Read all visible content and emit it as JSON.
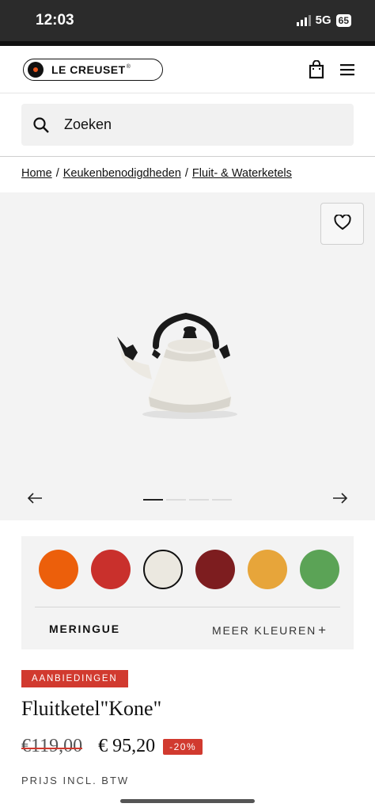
{
  "status_bar": {
    "time": "12:03",
    "network": "5G",
    "battery": "65"
  },
  "header": {
    "brand": "LE CREUSET",
    "brand_mark": "®",
    "icons": [
      "shopping-bag-icon",
      "menu-icon"
    ]
  },
  "search": {
    "placeholder": "Zoeken",
    "icon": "search-icon"
  },
  "breadcrumb": {
    "items": [
      "Home",
      "Keukenbenodigdheden",
      "Fluit- & Waterketels"
    ],
    "separator": "/"
  },
  "gallery": {
    "image_alt": "Fluitketel Kone Meringue",
    "slide_count": 4,
    "active_slide": 1,
    "icons": [
      "heart-icon",
      "arrow-left-icon",
      "arrow-right-icon"
    ]
  },
  "colors": {
    "swatches": [
      {
        "color": "#ec5f0b"
      },
      {
        "color": "#c9302c"
      },
      {
        "color": "#ebe8e0",
        "selected": true
      },
      {
        "color": "#7d1d1f"
      },
      {
        "color": "#e7a53a"
      },
      {
        "color": "#5ba356"
      }
    ],
    "selected_name": "MERINGUE",
    "more_label": "MEER KLEUREN",
    "more_icon": "+"
  },
  "product": {
    "badge": "AANBIEDINGEN",
    "title": "Fluitketel\"Kone\"",
    "old_price": "€119,00",
    "new_price": "€ 95,20",
    "discount": "-20%",
    "price_note": "PRIJS INCL. BTW"
  },
  "accent_color": "#d13a2f"
}
